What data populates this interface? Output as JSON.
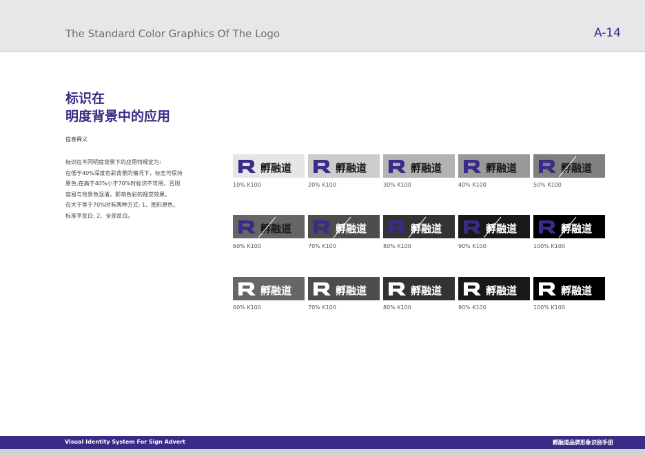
{
  "header": {
    "title": "The Standard Color Graphics Of The Logo",
    "page_number": "A-14"
  },
  "heading": {
    "line1": "标识在",
    "line2": "明度背景中的应用"
  },
  "subheading": "信息释义",
  "description": [
    "标识在不同明度背景下的应用特规定为:",
    "在低于40%深度色彩背景的情况下，标志可保持",
    "原色;在高于40%小于70%时标识不可用，否则",
    "容易与背景色混淆，影响色彩的视觉效果。",
    "在大于等于70%时有两种方式:    1、图形原色，",
    "标准字反白; 2、全部反白。"
  ],
  "logo_wordmark": "孵融道",
  "colors": {
    "brand": "#3b2a87",
    "header_bg": "#e6e7e8",
    "footer_bg": "#3b2a87"
  },
  "rows": [
    {
      "mode": "original",
      "tiles": [
        {
          "k": 10,
          "label": "10% K100",
          "strike": false
        },
        {
          "k": 20,
          "label": "20% K100",
          "strike": false
        },
        {
          "k": 30,
          "label": "30% K100",
          "strike": false
        },
        {
          "k": 40,
          "label": "40% K100",
          "strike": false
        },
        {
          "k": 50,
          "label": "50% K100",
          "strike": true
        }
      ]
    },
    {
      "mode": "original",
      "tiles": [
        {
          "k": 60,
          "label": "60% K100",
          "strike": true
        },
        {
          "k": 70,
          "label": "70% K100",
          "strike": true
        },
        {
          "k": 80,
          "label": "80% K100",
          "strike": true
        },
        {
          "k": 90,
          "label": "90% K100",
          "strike": true
        },
        {
          "k": 100,
          "label": "100% K100",
          "strike": true
        }
      ]
    },
    {
      "mode": "reversed",
      "tiles": [
        {
          "k": 60,
          "label": "60% K100",
          "strike": false
        },
        {
          "k": 70,
          "label": "70% K100",
          "strike": false
        },
        {
          "k": 80,
          "label": "80% K100",
          "strike": false
        },
        {
          "k": 90,
          "label": "90% K100",
          "strike": false
        },
        {
          "k": 100,
          "label": "100% K100",
          "strike": false
        }
      ]
    }
  ],
  "footer": {
    "left": "Visual Identity System For Sign Advert",
    "right": "孵融道品牌形象识别手册"
  }
}
